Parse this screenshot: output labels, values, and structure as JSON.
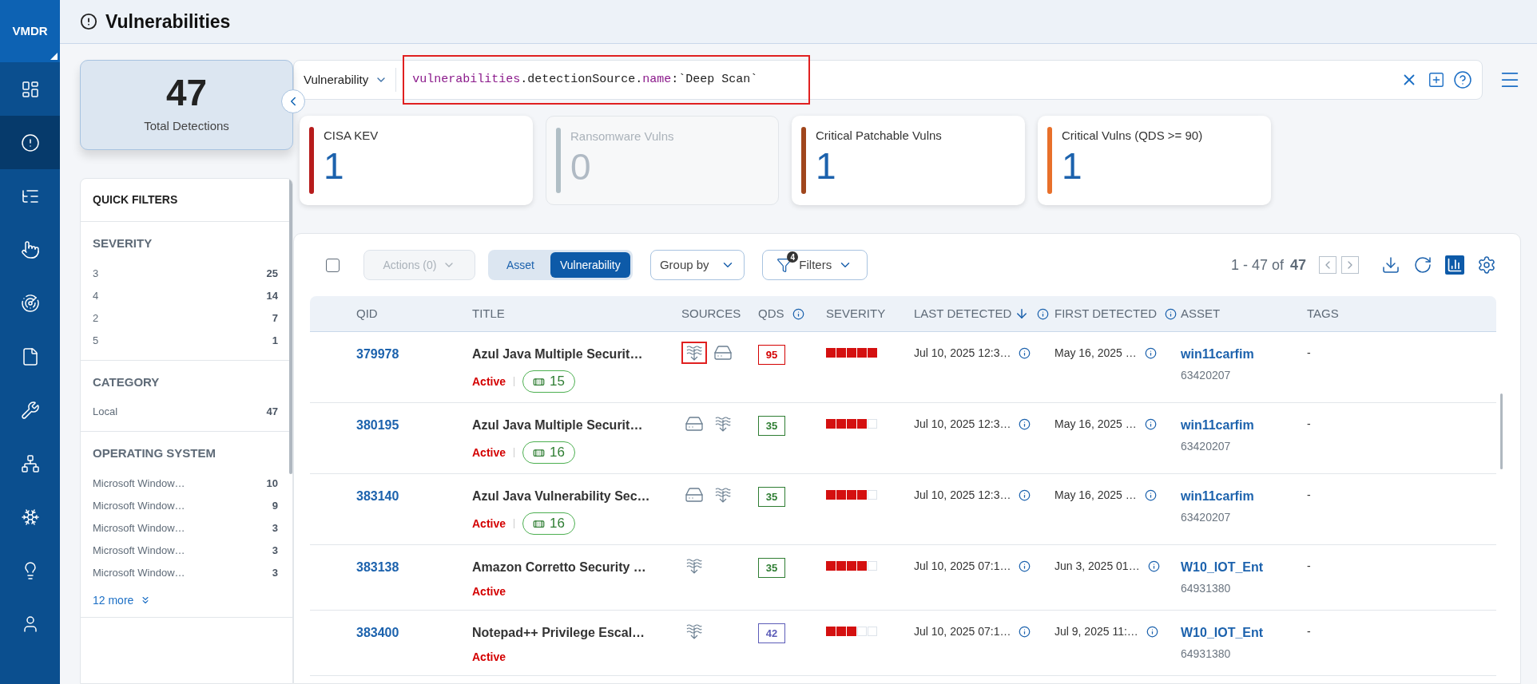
{
  "nav": {
    "product": "VMDR",
    "items": [
      {
        "selected": false
      },
      {
        "selected": true
      },
      {
        "selected": false
      },
      {
        "selected": false
      },
      {
        "selected": false
      },
      {
        "selected": false
      },
      {
        "selected": false
      },
      {
        "selected": false
      },
      {
        "selected": false
      },
      {
        "selected": false
      },
      {
        "selected": false
      }
    ]
  },
  "header": {
    "title": "Vulnerabilities"
  },
  "total": {
    "value": "47",
    "label": "Total Detections"
  },
  "quick_filters": {
    "title": "QUICK FILTERS",
    "sections": [
      {
        "title": "SEVERITY",
        "items": [
          {
            "label": "3",
            "count": "25"
          },
          {
            "label": "4",
            "count": "14"
          },
          {
            "label": "2",
            "count": "7"
          },
          {
            "label": "5",
            "count": "1"
          }
        ]
      },
      {
        "title": "CATEGORY",
        "items": [
          {
            "label": "Local",
            "count": "47"
          }
        ]
      },
      {
        "title": "OPERATING SYSTEM",
        "items": [
          {
            "label": "Microsoft Window…",
            "count": "10"
          },
          {
            "label": "Microsoft Window…",
            "count": "9"
          },
          {
            "label": "Microsoft Window…",
            "count": "3"
          },
          {
            "label": "Microsoft Window…",
            "count": "3"
          },
          {
            "label": "Microsoft Window…",
            "count": "3"
          }
        ],
        "more": "12 more"
      }
    ]
  },
  "search": {
    "scope": "Vulnerability",
    "highlighted": true,
    "query": [
      {
        "kind": "field",
        "text": "vulnerabilities"
      },
      {
        "kind": "plain",
        "text": ".detectionSource."
      },
      {
        "kind": "field",
        "text": "name"
      },
      {
        "kind": "plain",
        "text": ":`Deep Scan`"
      }
    ]
  },
  "cards": [
    {
      "label": "CISA KEV",
      "value": "1",
      "color": "#b71c1c",
      "disabled": false
    },
    {
      "label": "Ransomware Vulns",
      "value": "0",
      "color": "#b0bec5",
      "disabled": true
    },
    {
      "label": "Critical Patchable Vulns",
      "value": "1",
      "color": "#a0461c",
      "disabled": false
    },
    {
      "label": "Critical Vulns (QDS >= 90)",
      "value": "1",
      "color": "#e8702a",
      "disabled": false
    }
  ],
  "toolbar": {
    "select_all": {
      "checked": false
    },
    "actions": {
      "label": "Actions (0)",
      "disabled": true
    },
    "view_tabs": [
      {
        "label": "Asset",
        "selected": false
      },
      {
        "label": "Vulnerability",
        "selected": true
      }
    ],
    "group_by": "Group by",
    "filters": {
      "label": "Filters",
      "count": "4"
    },
    "pagination": {
      "range": "1 - 47 of",
      "total": "47"
    }
  },
  "table": {
    "columns": [
      {
        "label": "QID",
        "info": false,
        "sorted": false
      },
      {
        "label": "TITLE",
        "info": false,
        "sorted": false
      },
      {
        "label": "SOURCES",
        "info": false,
        "sorted": false
      },
      {
        "label": "QDS",
        "info": true,
        "sorted": false
      },
      {
        "label": "SEVERITY",
        "info": false,
        "sorted": false
      },
      {
        "label": "LAST DETECTED",
        "info": true,
        "sorted": true
      },
      {
        "label": "FIRST DETECTED",
        "info": true,
        "sorted": false
      },
      {
        "label": "ASSET",
        "info": false,
        "sorted": false
      },
      {
        "label": "TAGS",
        "info": false,
        "sorted": false
      }
    ],
    "rows": [
      {
        "qid": "379978",
        "title": "Azul Java Multiple Securit…",
        "status": "Active",
        "patches": "15",
        "sources": [
          {
            "kind": "scan",
            "highlighted": true
          },
          {
            "kind": "drive",
            "highlighted": false
          }
        ],
        "qds": "95",
        "color": "#d40000",
        "stars": 5,
        "last_detected": "Jul 10, 2025 12:3…",
        "first_detected": "May 16, 2025 …",
        "asset": "win11carfim",
        "asset_id": "63420207",
        "tags": "-"
      },
      {
        "qid": "380195",
        "title": "Azul Java Multiple Securit…",
        "status": "Active",
        "patches": "16",
        "sources": [
          {
            "kind": "drive",
            "highlighted": false
          },
          {
            "kind": "scan",
            "highlighted": false
          }
        ],
        "qds": "35",
        "color": "#2e7d32",
        "stars": 4,
        "last_detected": "Jul 10, 2025 12:3…",
        "first_detected": "May 16, 2025 …",
        "asset": "win11carfim",
        "asset_id": "63420207",
        "tags": "-"
      },
      {
        "qid": "383140",
        "title": "Azul Java Vulnerability Sec…",
        "status": "Active",
        "patches": "16",
        "sources": [
          {
            "kind": "drive",
            "highlighted": false
          },
          {
            "kind": "scan",
            "highlighted": false
          }
        ],
        "qds": "35",
        "color": "#2e7d32",
        "stars": 4,
        "last_detected": "Jul 10, 2025 12:3…",
        "first_detected": "May 16, 2025 …",
        "asset": "win11carfim",
        "asset_id": "63420207",
        "tags": "-"
      },
      {
        "qid": "383138",
        "title": "Amazon Corretto Security …",
        "status": "Active",
        "sources": [
          {
            "kind": "scan",
            "highlighted": false
          }
        ],
        "qds": "35",
        "color": "#2e7d32",
        "stars": 4,
        "last_detected": "Jul 10, 2025 07:1…",
        "first_detected": "Jun 3, 2025 01…",
        "asset": "W10_IOT_Ent",
        "asset_id": "64931380",
        "tags": "-"
      },
      {
        "qid": "383400",
        "title": "Notepad++ Privilege Escal…",
        "status": "Active",
        "sources": [
          {
            "kind": "scan",
            "highlighted": false
          }
        ],
        "qds": "42",
        "color": "#5c5cb8",
        "stars": 3,
        "last_detected": "Jul 10, 2025 07:1…",
        "first_detected": "Jul 9, 2025 11:…",
        "asset": "W10_IOT_Ent",
        "asset_id": "64931380",
        "tags": "-"
      }
    ]
  }
}
